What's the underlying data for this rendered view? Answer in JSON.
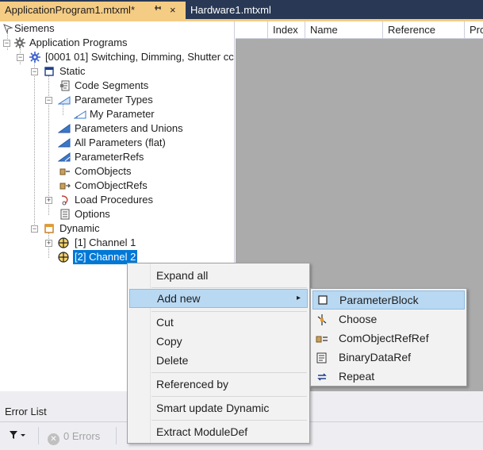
{
  "tabs": [
    {
      "label": "ApplicationProgram1.mtxml*",
      "active": true,
      "pin": "pin-icon",
      "close": "×"
    },
    {
      "label": "Hardware1.mtxml",
      "active": false
    }
  ],
  "tree": {
    "items": [
      {
        "label": "Siemens",
        "icon": "manufacturer-icon"
      },
      {
        "label": "Application Programs",
        "icon": "gear-icon"
      },
      {
        "label": "[0001 01] Switching, Dimming, Shutter cc",
        "icon": "gear-blue-icon"
      },
      {
        "label": "Static",
        "icon": "static-icon"
      },
      {
        "label": "Code Segments",
        "icon": "code-segments-icon"
      },
      {
        "label": "Parameter Types",
        "icon": "parameter-types-icon"
      },
      {
        "label": "My Parameter",
        "icon": "parameter-type-icon"
      },
      {
        "label": "Parameters and Unions",
        "icon": "parameters-icon"
      },
      {
        "label": "All Parameters (flat)",
        "icon": "parameters-flat-icon"
      },
      {
        "label": "ParameterRefs",
        "icon": "parameter-refs-icon"
      },
      {
        "label": "ComObjects",
        "icon": "comobjects-icon"
      },
      {
        "label": "ComObjectRefs",
        "icon": "comobject-refs-icon"
      },
      {
        "label": "Load Procedures",
        "icon": "load-procedures-icon"
      },
      {
        "label": "Options",
        "icon": "options-icon"
      },
      {
        "label": "Dynamic",
        "icon": "dynamic-icon"
      },
      {
        "label": "[1] Channel 1",
        "icon": "channel-icon"
      },
      {
        "label": "[2] Channel 2",
        "icon": "channel-icon",
        "selected": true
      }
    ]
  },
  "grid": {
    "columns": [
      "",
      "Index",
      "Name",
      "Reference",
      "Pro"
    ]
  },
  "context_menu": {
    "items": [
      {
        "label": "Expand all"
      },
      {
        "label": "Add new",
        "highlighted": true,
        "has_submenu": true
      },
      {
        "label": "Cut"
      },
      {
        "label": "Copy"
      },
      {
        "label": "Delete"
      },
      {
        "label": "Referenced by"
      },
      {
        "label": "Smart update Dynamic"
      },
      {
        "label": "Extract ModuleDef"
      }
    ],
    "submenu_arrow": "▸"
  },
  "submenu": {
    "items": [
      {
        "label": "ParameterBlock",
        "icon": "parameter-block-icon",
        "highlighted": true
      },
      {
        "label": "Choose",
        "icon": "choose-icon"
      },
      {
        "label": "ComObjectRefRef",
        "icon": "comobject-ref-ref-icon"
      },
      {
        "label": "BinaryDataRef",
        "icon": "binary-data-ref-icon"
      },
      {
        "label": "Repeat",
        "icon": "repeat-icon"
      }
    ]
  },
  "error_list": {
    "title": "Error List",
    "errors_label": "0 Errors",
    "filter_icon": "filter-icon"
  },
  "colors": {
    "tab_active": "#f5cc84",
    "tab_strip": "#293955",
    "selection": "#0078d7",
    "menu_highlight": "#b9d9f3",
    "grid_background": "#ababab"
  }
}
